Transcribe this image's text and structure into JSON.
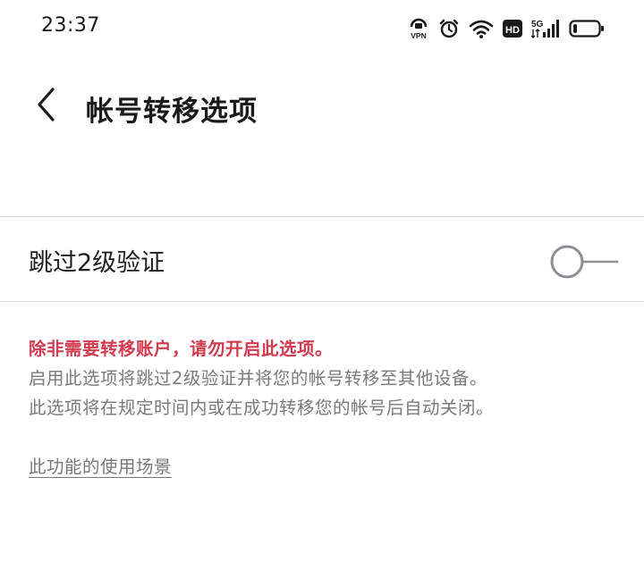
{
  "status_bar": {
    "time": "23:37",
    "vpn_label": "VPN",
    "hd_label": "HD",
    "network_label": "5G",
    "icons": [
      "vpn-icon",
      "alarm-icon",
      "wifi-icon",
      "hd-icon",
      "signal-5g-icon",
      "battery-icon"
    ],
    "battery_level": 0.15
  },
  "header": {
    "back_icon": "chevron-left-icon",
    "title": "帐号转移选项"
  },
  "setting": {
    "label": "跳过2级验证",
    "toggle_on": false
  },
  "notes": {
    "warning": "除非需要转移账户，请勿开启此选项。",
    "line1": "启用此选项将跳过2级验证并将您的帐号转移至其他设备。",
    "line2": "此选项将在规定时间内或在成功转移您的帐号后自动关闭。"
  },
  "link": {
    "usage_label": "此功能的使用场景"
  },
  "colors": {
    "background": "#ffffff",
    "warning": "#d23a4e",
    "secondary_text": "#7a7a7a",
    "toggle_off": "#8a8f96",
    "divider": "#dddddd"
  }
}
